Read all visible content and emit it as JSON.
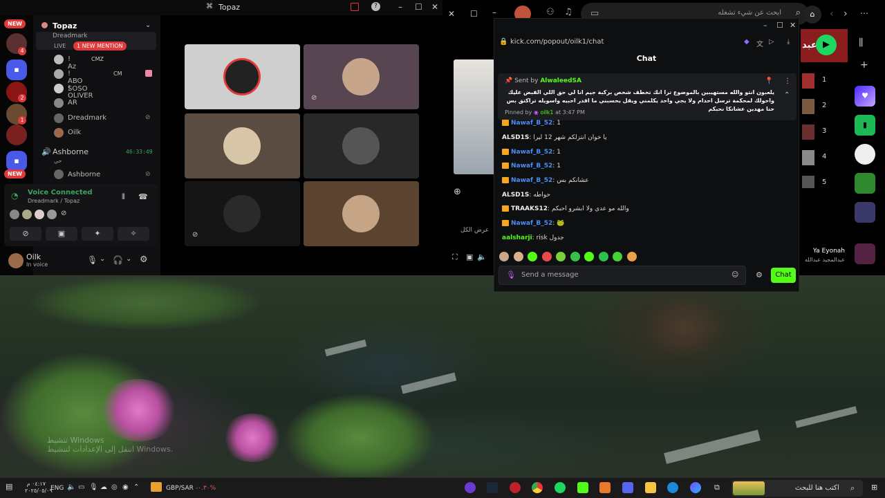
{
  "discord": {
    "title": "Topaz",
    "server_name": "Topaz",
    "new_badge": "NEW",
    "rail_counts": [
      "4",
      "2",
      "1"
    ],
    "mention_label": "1 NEW MENTION",
    "live_label": "LIVE",
    "stage_name": "Dreadmark",
    "members": [
      {
        "name": "! Az",
        "tag": "CMZ"
      },
      {
        "name": "! ABO SOSO",
        "tag": "CM"
      },
      {
        "name": "! OLIVER",
        "tag": ""
      },
      {
        "name": "AR",
        "tag": ""
      },
      {
        "name": "Dreadmark",
        "tag": ""
      },
      {
        "name": "Oilk",
        "tag": ""
      }
    ],
    "voice_channel": {
      "name": "Ashborne",
      "timer": "46:33:49",
      "sub": "حي"
    },
    "voice_member": "Ashborne",
    "voice_connected": "Voice Connected",
    "voice_location": "Dreadmark / Topaz",
    "user": {
      "name": "Oilk",
      "status": "In voice"
    },
    "colors": {
      "accent_red": "#e03a3a",
      "voice_green": "#3ba55c"
    }
  },
  "kick": {
    "url": "kick.com/popout/oilk1/chat",
    "header": "Chat",
    "pinned": {
      "sent_by_label": "Sent by",
      "sender": "AlwaleedSA",
      "text": "يلعبون انتو والله مستهيبين بالموضوع ترا انك تخطف شخص بركبة جيم انا لي حق اللي القبض عليك واحولك لمحكمة ترسل احدام ولا يجي واحد يكلمني ويقل يحسبني ما اقدر احبيه واسويله تراكتق بس حنا مهدين عشانكا نحبكم",
      "pinned_by_label": "Pinned by",
      "pinned_by": "oilk1",
      "time": "at 3:47 PM"
    },
    "messages": [
      {
        "user": "Nawaf_B_52",
        "text": "1",
        "crown": true,
        "color": "blue"
      },
      {
        "user": "ALSD1S",
        "text": "يا خوان انتزلكم شهر 12 ليرا",
        "crown": false,
        "color": "white"
      },
      {
        "user": "Nawaf_B_52",
        "text": "1",
        "crown": true,
        "color": "blue"
      },
      {
        "user": "Nawaf_B_52",
        "text": "1",
        "crown": true,
        "color": "blue"
      },
      {
        "user": "Nawaf_B_52",
        "text": "عشانكم بس",
        "crown": true,
        "color": "blue"
      },
      {
        "user": "ALSD1S",
        "text": "حواطه",
        "crown": false,
        "color": "white"
      },
      {
        "user": "TRAAKS12",
        "text": "والله مو عدي ولا ابشرو احبكم",
        "crown": true,
        "color": "white"
      },
      {
        "user": "Nawaf_B_52",
        "text": "🐸",
        "crown": true,
        "color": "blue"
      },
      {
        "user": "aalsharji",
        "text": "risk جدول",
        "crown": false,
        "color": "green"
      }
    ],
    "input_placeholder": "Send a message",
    "send_label": "Chat",
    "colors": {
      "brand_green": "#53fc18",
      "username_blue": "#4f8df5"
    }
  },
  "browser": {
    "search_placeholder": "ابحث عن شيء تشغله",
    "stream_link": "عرض الكل",
    "spotify_queue": [
      "1",
      "2",
      "3",
      "4",
      "5"
    ],
    "now_playing_title": "Ya Eyonah",
    "now_playing_artist": "عبدالمجيد عبدالله",
    "top_label": "عبد"
  },
  "desktop": {
    "watermark_line1": "تنشيط Windows",
    "watermark_line2": "انتقل إلى الإعدادات لتنشيط Windows."
  },
  "taskbar": {
    "currency": "GBP/SAR",
    "currency_change": "-٠.٣٠%",
    "lang": "ENG",
    "time": "٠٤:١٧ م",
    "date": "٢٠٢٥/٠٥/٠٩",
    "search_placeholder": "اكتب هنا للبحث"
  }
}
